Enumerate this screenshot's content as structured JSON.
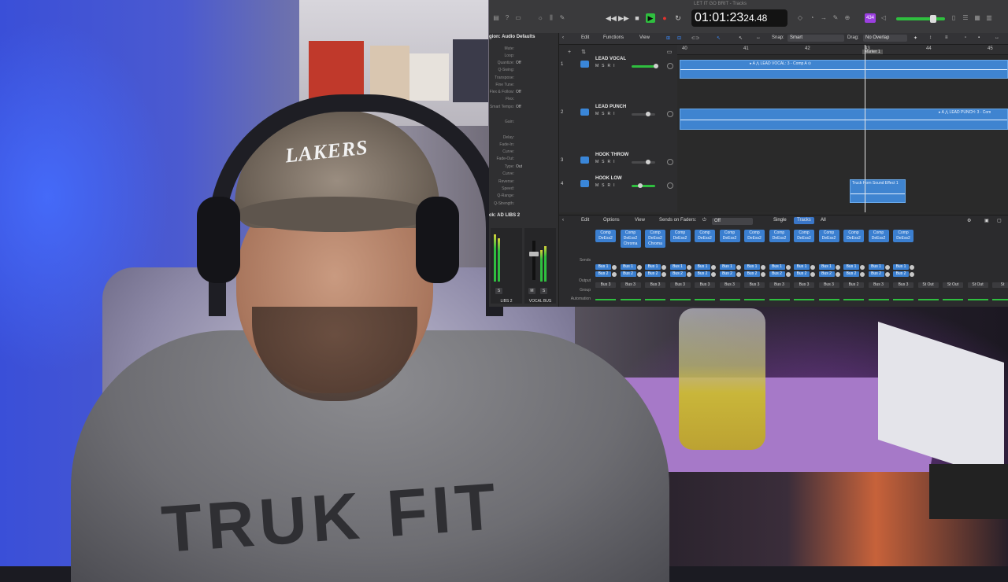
{
  "overlay": {
    "window_title": "LET IT GO BRIT - Tracks",
    "transport": {
      "timecode_main": "01:01:23",
      "timecode_frames": "24.48",
      "rewind": "◀◀",
      "forward": "▶▶",
      "stop": "■",
      "play": "▶",
      "record": "●",
      "cycle": "↻",
      "master_count": "434"
    },
    "inspector": {
      "region_header": "gion: Audio Defaults",
      "rows": [
        {
          "k": "Mute:",
          "v": ""
        },
        {
          "k": "Loop:",
          "v": ""
        },
        {
          "k": "Quantize:",
          "v": "Off"
        },
        {
          "k": "Q-Swing:",
          "v": ""
        },
        {
          "k": "Transpose:",
          "v": ""
        },
        {
          "k": "Fine Tune:",
          "v": ""
        },
        {
          "k": "Flex & Follow:",
          "v": "Off"
        },
        {
          "k": "Flex:",
          "v": ""
        },
        {
          "k": "Smart Tempo:",
          "v": "Off"
        },
        {
          "k": "Gain:",
          "v": ""
        },
        {
          "k": "Delay:",
          "v": ""
        },
        {
          "k": "Fade-In:",
          "v": ""
        },
        {
          "k": "Curve:",
          "v": ""
        },
        {
          "k": "Fade-Out:",
          "v": ""
        },
        {
          "k": "Type:",
          "v": "Out"
        },
        {
          "k": "Curve:",
          "v": ""
        },
        {
          "k": "Reverse:",
          "v": ""
        },
        {
          "k": "Speed:",
          "v": ""
        },
        {
          "k": "Q-Range:",
          "v": ""
        },
        {
          "k": "Q-Strength:",
          "v": ""
        }
      ],
      "track_header": "ck: AD LIBS 2",
      "strip_left_name": "LIBS 2",
      "strip_right_name": "VOCAL BUS",
      "strip_btn_m": "M",
      "strip_btn_s": "S"
    },
    "tracks_toolbar": {
      "edit": "Edit",
      "functions": "Functions",
      "view": "View",
      "snap_label": "Snap:",
      "snap_value": "Smart",
      "drag_label": "Drag:",
      "drag_value": "No Overlap"
    },
    "ruler": {
      "bars": [
        "40",
        "41",
        "42",
        "43",
        "44",
        "45"
      ],
      "marker": "Marker 1"
    },
    "tracks": [
      {
        "num": "1",
        "name": "LEAD VOCAL",
        "msr": "MSRI"
      },
      {
        "num": "2",
        "name": "LEAD PUNCH",
        "msr": "MSRI"
      },
      {
        "num": "3",
        "name": "HOOK THROW",
        "msr": "MSRI"
      },
      {
        "num": "4",
        "name": "HOOK LOW",
        "msr": "MSRI"
      }
    ],
    "regions": [
      {
        "name": "▸ A ⋀ LEAD VOCAL: 3 - Comp A ⊙"
      },
      {
        "name": "▸ A ⋀ LEAD PUNCH: 3 - Com"
      },
      {
        "name": "Truck Horn Sound Effect 1"
      }
    ],
    "mixer": {
      "edit": "Edit",
      "options": "Options",
      "view": "View",
      "sends_on_faders_label": "Sends on Faders:",
      "sends_on_faders_value": "Off",
      "tab_single": "Single",
      "tab_tracks": "Tracks",
      "tab_all": "All",
      "labels": {
        "sends": "Sends",
        "output": "Output",
        "group": "Group",
        "automation": "Automation"
      },
      "channels": [
        {
          "plugins": [
            "Comp",
            "DeEss2"
          ],
          "bus1": "Bus 1",
          "bus2": "Bus 2",
          "output": "Bus 3"
        },
        {
          "plugins": [
            "Comp",
            "DeEss2",
            "Chroma"
          ],
          "bus1": "Bus 1",
          "bus2": "Bus 2",
          "output": "Bus 3"
        },
        {
          "plugins": [
            "Comp",
            "DeEss2",
            "Chroma"
          ],
          "bus1": "Bus 1",
          "bus2": "Bus 2",
          "output": "Bus 3"
        },
        {
          "plugins": [
            "Comp",
            "DeEss2"
          ],
          "bus1": "Bus 1",
          "bus2": "Bus 2",
          "output": "Bus 3"
        },
        {
          "plugins": [
            "Comp",
            "DeEss2"
          ],
          "bus1": "Bus 1",
          "bus2": "Bus 2",
          "output": "Bus 3"
        },
        {
          "plugins": [
            "Comp",
            "DeEss2"
          ],
          "bus1": "Bus 1",
          "bus2": "Bus 2",
          "output": "Bus 3"
        },
        {
          "plugins": [
            "Comp",
            "DeEss2"
          ],
          "bus1": "Bus 1",
          "bus2": "Bus 2",
          "output": "Bus 3"
        },
        {
          "plugins": [
            "Comp",
            "DeEss2"
          ],
          "bus1": "Bus 1",
          "bus2": "Bus 2",
          "output": "Bus 3"
        },
        {
          "plugins": [
            "Comp",
            "DeEss2"
          ],
          "bus1": "Bus 1",
          "bus2": "Bus 2",
          "output": "Bus 3"
        },
        {
          "plugins": [
            "Comp",
            "DeEss2"
          ],
          "bus1": "Bus 1",
          "bus2": "Bus 2",
          "output": "Bus 3"
        },
        {
          "plugins": [
            "Comp",
            "DeEss2"
          ],
          "bus1": "Bus 1",
          "bus2": "Bus 2",
          "output": "Bus 2"
        },
        {
          "plugins": [
            "Comp",
            "DeEss2"
          ],
          "bus1": "Bus 1",
          "bus2": "Bus 2",
          "output": "Bus 3"
        },
        {
          "plugins": [
            "Comp",
            "DeEss2"
          ],
          "bus1": "Bus 1",
          "bus2": "Bus 2",
          "output": "Bus 3"
        },
        {
          "plugins": [],
          "bus1": "",
          "bus2": "",
          "output": "St Out"
        },
        {
          "plugins": [],
          "bus1": "",
          "bus2": "",
          "output": "St Out"
        },
        {
          "plugins": [],
          "bus1": "",
          "bus2": "",
          "output": "St Out"
        },
        {
          "plugins": [],
          "bus1": "",
          "bus2": "",
          "output": "St"
        }
      ]
    }
  },
  "webcam": {
    "cap_text": "LAKERS",
    "shirt_text": "TRUK FIT"
  },
  "colors": {
    "region_blue": "#3f84d0",
    "play_green": "#2fbf3f",
    "record_red": "#e5322e",
    "selected_tab": "#3a76c8"
  }
}
